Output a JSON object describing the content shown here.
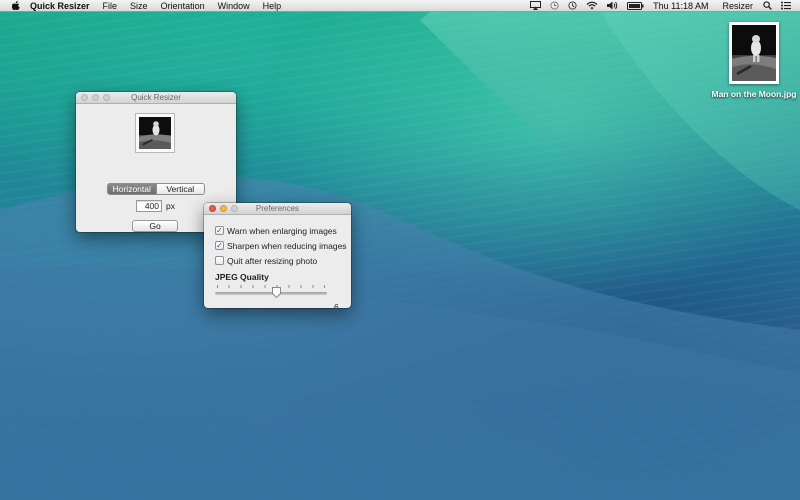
{
  "menubar": {
    "app_name": "Quick Resizer",
    "menus": [
      "File",
      "Size",
      "Orientation",
      "Window",
      "Help"
    ],
    "clock": "Thu 11:18 AM",
    "right_menu": "Resizer",
    "status_icons": [
      "airplay-icon",
      "time-machine-icon",
      "history-icon",
      "wifi-icon",
      "volume-icon",
      "battery-icon"
    ]
  },
  "desktop": {
    "file_name": "Man on the Moon.jpg"
  },
  "quick_resizer": {
    "title": "Quick Resizer",
    "orientation_options": [
      "Horizontal",
      "Vertical"
    ],
    "orientation_selected": "Horizontal",
    "size_value": "400",
    "size_unit": "px",
    "go_label": "Go"
  },
  "preferences": {
    "title": "Preferences",
    "options": [
      {
        "label": "Warn when enlarging images",
        "checked": true
      },
      {
        "label": "Sharpen when reducing images",
        "checked": true
      },
      {
        "label": "Quit after resizing photo",
        "checked": false
      }
    ],
    "jpeg_quality_label": "JPEG Quality",
    "jpeg_quality_value": "6",
    "jpeg_quality_fraction": 0.55
  },
  "colors": {
    "close_button": "#ec5a52",
    "minimize_button": "#f2bc3b",
    "selected_segment": "#7a7a7a",
    "checkbox_tick": "#1a4fa8"
  }
}
